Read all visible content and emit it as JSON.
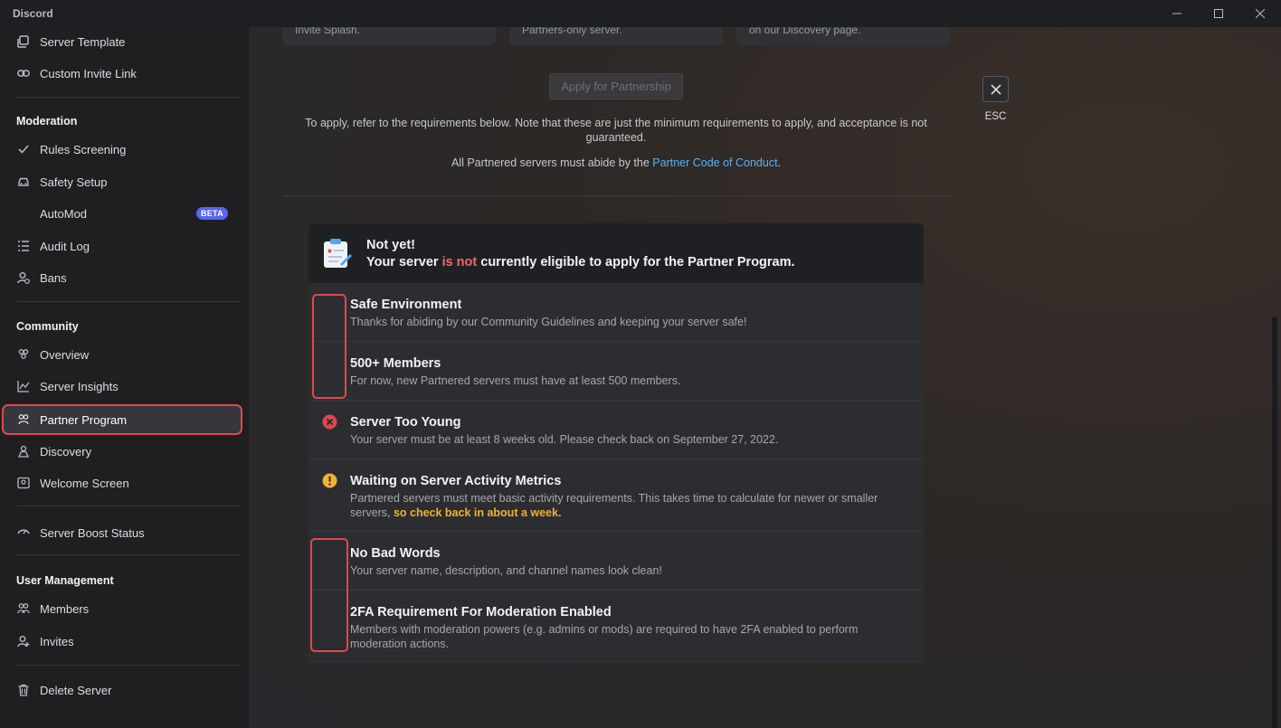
{
  "app": {
    "title": "Discord"
  },
  "sidebar": {
    "items_top": [
      {
        "label": "Server Template",
        "icon": "template-icon"
      },
      {
        "label": "Custom Invite Link",
        "icon": "link-icon"
      }
    ],
    "moderation": {
      "header": "Moderation",
      "items": [
        {
          "label": "Rules Screening",
          "icon": "check-icon"
        },
        {
          "label": "Safety Setup",
          "icon": "car-icon"
        },
        {
          "label": "AutoMod",
          "icon": "",
          "badge": "BETA"
        },
        {
          "label": "Audit Log",
          "icon": "list-icon"
        },
        {
          "label": "Bans",
          "icon": "ban-icon"
        }
      ]
    },
    "community": {
      "header": "Community",
      "items": [
        {
          "label": "Overview",
          "icon": "people-icon"
        },
        {
          "label": "Server Insights",
          "icon": "chart-icon"
        },
        {
          "label": "Partner Program",
          "icon": "partner-icon"
        },
        {
          "label": "Discovery",
          "icon": "discovery-icon"
        },
        {
          "label": "Welcome Screen",
          "icon": "welcome-icon"
        }
      ]
    },
    "boost": {
      "label": "Server Boost Status",
      "icon": "boost-icon"
    },
    "user_management": {
      "header": "User Management",
      "items": [
        {
          "label": "Members",
          "icon": "members-icon"
        },
        {
          "label": "Invites",
          "icon": "invite-icon"
        }
      ]
    },
    "delete": {
      "label": "Delete Server",
      "icon": "trash-icon"
    }
  },
  "main": {
    "cards_top": [
      "Invite Splash.",
      "Partners-only server.",
      "on our Discovery page."
    ],
    "apply_button": "Apply for Partnership",
    "requirements_note": "To apply, refer to the requirements below. Note that these are just the minimum requirements to apply, and acceptance is not guaranteed.",
    "abide_prefix": "All Partnered servers must abide by the ",
    "abide_link": "Partner Code of Conduct",
    "abide_suffix": ".",
    "close_label": "ESC",
    "eligibility": {
      "title": "Not yet!",
      "subtitle_prefix": "Your server ",
      "subtitle_emph": "is not",
      "subtitle_suffix": " currently eligible to apply for the Partner Program.",
      "requirements": [
        {
          "title": "Safe Environment",
          "desc": "Thanks for abiding by our Community Guidelines and keeping your server safe!",
          "status": "none"
        },
        {
          "title": "500+ Members",
          "desc": "For now, new Partnered servers must have at least 500 members.",
          "status": "none"
        },
        {
          "title": "Server Too Young",
          "desc": "Your server must be at least 8 weeks old. Please check back on September 27, 2022.",
          "status": "fail"
        },
        {
          "title": "Waiting on Server Activity Metrics",
          "desc": "Partnered servers must meet basic activity requirements. This takes time to calculate for newer or smaller servers, ",
          "desc_warn": "so check back in about a week.",
          "status": "warning"
        },
        {
          "title": "No Bad Words",
          "desc": "Your server name, description, and channel names look clean!",
          "status": "none"
        },
        {
          "title": "2FA Requirement For Moderation Enabled",
          "desc": "Members with moderation powers (e.g. admins or mods) are required to have 2FA enabled to perform moderation actions.",
          "status": "none"
        }
      ]
    }
  },
  "colors": {
    "accent": "#5865f2",
    "highlight_outline": "#e2474b",
    "link": "#5bb0f7",
    "error": "#e2474b",
    "warning": "#f0b232"
  }
}
